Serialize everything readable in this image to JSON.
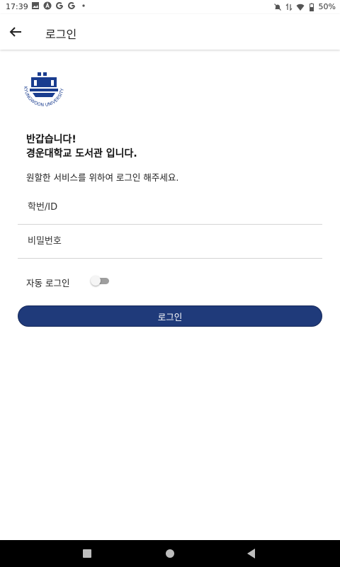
{
  "status_bar": {
    "time": "17:39",
    "battery": "50%",
    "notification_icons": [
      "image-icon",
      "a-icon",
      "google-icon",
      "google-icon"
    ]
  },
  "app_bar": {
    "title": "로그인"
  },
  "greeting": {
    "line1": "반갑습니다!",
    "line2": "경운대학교 도서관 입니다."
  },
  "subtext": "원할한 서비스를 위하여 로그인 해주세요.",
  "form": {
    "id_placeholder": "학번/ID",
    "id_value": "",
    "pw_placeholder": "비밀번호",
    "pw_value": "",
    "auto_login_label": "자동 로그인",
    "auto_login_on": false,
    "login_button": "로그인"
  },
  "colors": {
    "primary": "#1f3a7a",
    "logo": "#1a3d8f"
  }
}
